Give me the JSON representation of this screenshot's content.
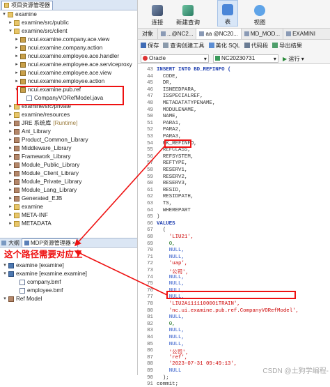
{
  "left_panel": {
    "tab_title": "项目资源管理器",
    "tree": [
      {
        "label": "examine",
        "icon": "folder-icon",
        "expanded": true,
        "indent": 0
      },
      {
        "label": "examine/src/public",
        "icon": "folder-icon",
        "expanded": false,
        "indent": 1
      },
      {
        "label": "examine/src/client",
        "icon": "folder-icon",
        "expanded": true,
        "indent": 1
      },
      {
        "label": "ncui.examine.company.ace.view",
        "icon": "package-icon",
        "expanded": false,
        "indent": 2
      },
      {
        "label": "ncui.examine.company.action",
        "icon": "package-icon",
        "expanded": false,
        "indent": 2
      },
      {
        "label": "ncui.examine.employee.ace.handler",
        "icon": "package-icon",
        "expanded": false,
        "indent": 2
      },
      {
        "label": "ncui.examine.employee.ace.serviceproxy",
        "icon": "package-icon",
        "expanded": false,
        "indent": 2
      },
      {
        "label": "ncui.examine.employee.ace.view",
        "icon": "package-icon",
        "expanded": false,
        "indent": 2
      },
      {
        "label": "ncui.examine.employee.action",
        "icon": "package-icon",
        "expanded": false,
        "indent": 2
      },
      {
        "label": "ncui.examine.pub.ref",
        "icon": "package-icon",
        "expanded": true,
        "indent": 2
      },
      {
        "label": "CompanyVORefModel.java",
        "icon": "java-file-icon",
        "expanded": null,
        "indent": 3
      },
      {
        "label": "examine/src/private",
        "icon": "folder-icon",
        "expanded": false,
        "indent": 1
      },
      {
        "label": "examine/resources",
        "icon": "folder-icon",
        "expanded": false,
        "indent": 1
      },
      {
        "label": "JRE 系统库",
        "suffix": "[Runtime]",
        "icon": "library-icon",
        "expanded": false,
        "indent": 1
      },
      {
        "label": "Ant_Library",
        "icon": "library-icon",
        "expanded": false,
        "indent": 1
      },
      {
        "label": "Product_Common_Library",
        "icon": "library-icon",
        "expanded": false,
        "indent": 1
      },
      {
        "label": "Middleware_Library",
        "icon": "library-icon",
        "expanded": false,
        "indent": 1
      },
      {
        "label": "Framework_Library",
        "icon": "library-icon",
        "expanded": false,
        "indent": 1
      },
      {
        "label": "Module_Public_Library",
        "icon": "library-icon",
        "expanded": false,
        "indent": 1
      },
      {
        "label": "Module_Client_Library",
        "icon": "library-icon",
        "expanded": false,
        "indent": 1
      },
      {
        "label": "Module_Private_Library",
        "icon": "library-icon",
        "expanded": false,
        "indent": 1
      },
      {
        "label": "Module_Lang_Library",
        "icon": "library-icon",
        "expanded": false,
        "indent": 1
      },
      {
        "label": "Generated_EJB",
        "icon": "library-icon",
        "expanded": false,
        "indent": 1
      },
      {
        "label": "examine",
        "icon": "folder-icon",
        "expanded": false,
        "indent": 1
      },
      {
        "label": "META-INF",
        "icon": "folder-icon",
        "expanded": false,
        "indent": 1
      },
      {
        "label": "METADATA",
        "icon": "folder-icon",
        "expanded": false,
        "indent": 1
      }
    ]
  },
  "mdp_panel": {
    "tab_outline": "大纲",
    "tab_mdp": "MDP资源管理器",
    "annotation": "这个路径需要对应上",
    "tree": [
      {
        "label": "examine [examine]",
        "icon": "project-icon",
        "indent": 0
      },
      {
        "label": "examine [examine.examine]",
        "icon": "project-icon",
        "indent": 0
      },
      {
        "label": "company.bmf",
        "icon": "file-icon",
        "indent": 1
      },
      {
        "label": "employee.bmf",
        "icon": "file-icon",
        "indent": 1
      },
      {
        "label": "Ref Model",
        "icon": "model-icon",
        "indent": 0
      }
    ]
  },
  "toolbar": {
    "connect": "连接",
    "new_query": "新建查询",
    "table": "表",
    "view": "视图"
  },
  "object_tabs": {
    "label": "对象",
    "tabs": [
      "...@NC2...",
      "aa @NC20...",
      "MD_MOD...",
      "EXAMINI"
    ]
  },
  "action_bar": {
    "save": "保存",
    "query_builder": "查询创建工具",
    "beautify": "美化 SQL",
    "snippet": "代码段",
    "export": "导出结果"
  },
  "conn_bar": {
    "db": "Oracle",
    "schema": "NC20230731",
    "run": "运行"
  },
  "code": [
    {
      "n": "43",
      "t": "INSERT INTO BD_REFINFO (",
      "k": "kw"
    },
    {
      "n": "44",
      "t": "  CODE,"
    },
    {
      "n": "45",
      "t": "  DR,"
    },
    {
      "n": "46",
      "t": "  ISNEEDPARA,"
    },
    {
      "n": "47",
      "t": "  ISSPECIALREF,"
    },
    {
      "n": "48",
      "t": "  METADATATYPENAME,"
    },
    {
      "n": "49",
      "t": "  MODULENAME,"
    },
    {
      "n": "50",
      "t": "  NAME,"
    },
    {
      "n": "51",
      "t": "  PARA1,"
    },
    {
      "n": "52",
      "t": "  PARA2,"
    },
    {
      "n": "53",
      "t": "  PARA3,"
    },
    {
      "n": "54",
      "t": "  PK_REFINFO,"
    },
    {
      "n": "55",
      "t": "  REFCLASS,"
    },
    {
      "n": "56",
      "t": "  REFSYSTEM,"
    },
    {
      "n": "57",
      "t": "  REFTYPE,"
    },
    {
      "n": "58",
      "t": "  RESERV1,"
    },
    {
      "n": "59",
      "t": "  RESERV2,"
    },
    {
      "n": "60",
      "t": "  RESERV3,"
    },
    {
      "n": "61",
      "t": "  RESID,"
    },
    {
      "n": "62",
      "t": "  RESIDPATH,"
    },
    {
      "n": "63",
      "t": "  TS,"
    },
    {
      "n": "64",
      "t": "  WHEREPART"
    },
    {
      "n": "65",
      "t": ")"
    },
    {
      "n": "66",
      "t": "VALUES",
      "k": "kw"
    },
    {
      "n": "67",
      "t": "  ("
    },
    {
      "n": "68",
      "t": "    'LIU21',",
      "k": "str"
    },
    {
      "n": "69",
      "t": "    0,",
      "k": "num"
    },
    {
      "n": "70",
      "t": "    NULL,",
      "k": "nul"
    },
    {
      "n": "71",
      "t": "    NULL,",
      "k": "nul"
    },
    {
      "n": "72",
      "t": "    'uap',",
      "k": "str"
    },
    {
      "n": "73",
      "t": "    '公司',",
      "k": "str"
    },
    {
      "n": "74",
      "t": "    NULL,",
      "k": "nul"
    },
    {
      "n": "75",
      "t": "    NULL,",
      "k": "nul"
    },
    {
      "n": "76",
      "t": "    NULL,",
      "k": "nul"
    },
    {
      "n": "77",
      "t": "    NULL,",
      "k": "nul"
    },
    {
      "n": "78",
      "t": "    'LIU2A1111100001TRAIN',",
      "k": "str"
    },
    {
      "n": "80",
      "t": "    'nc.ui.examine.pub.ref.CompanyVORefModel',",
      "k": "str"
    },
    {
      "n": "81",
      "t": "    NULL,",
      "k": "nul"
    },
    {
      "n": "82",
      "t": "    0,",
      "k": "num"
    },
    {
      "n": "83",
      "t": "    NULL,",
      "k": "nul"
    },
    {
      "n": "84",
      "t": "    NULL,",
      "k": "nul"
    },
    {
      "n": "85",
      "t": "    NULL,",
      "k": "nul"
    },
    {
      "n": "86",
      "t": "    '公司',",
      "k": "str"
    },
    {
      "n": "87",
      "t": "    'ref',",
      "k": "str"
    },
    {
      "n": "88",
      "t": "    '2023-07-31 09:49:13',",
      "k": "str"
    },
    {
      "n": "89",
      "t": "    NULL",
      "k": "nul"
    },
    {
      "n": "90",
      "t": "  );"
    },
    {
      "n": "91",
      "t": "commit;"
    }
  ],
  "watermark": "CSDN @土狗学编程-"
}
